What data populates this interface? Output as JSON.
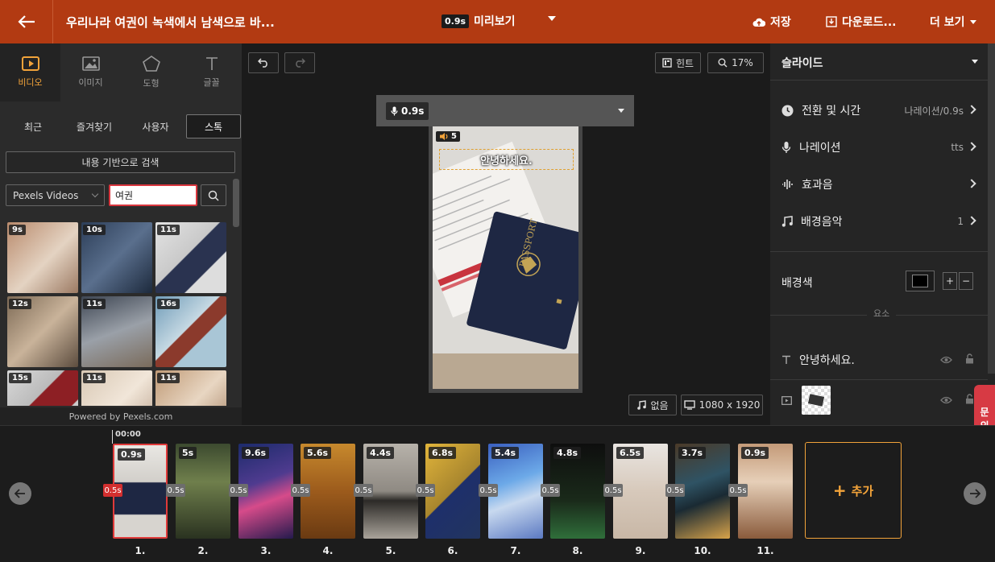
{
  "header": {
    "title": "우리나라 여권이 녹색에서 남색으로 바...",
    "preview_duration": "0.9s",
    "preview_label": "미리보기",
    "save_label": "저장",
    "download_label": "다운로드...",
    "more_label": "더 보기",
    "accent_color": "#b23a12"
  },
  "left_panel": {
    "tabs": [
      {
        "label": "비디오",
        "icon": "video-icon",
        "active": true
      },
      {
        "label": "이미지",
        "icon": "image-icon"
      },
      {
        "label": "도형",
        "icon": "pentagon-icon"
      },
      {
        "label": "글꼴",
        "icon": "text-icon"
      }
    ],
    "subtabs": [
      "최근",
      "즐겨찾기",
      "사용자",
      "스톡"
    ],
    "active_subtab": "스톡",
    "content_search_label": "내용 기반으로 검색",
    "source_select": "Pexels Videos",
    "search_value": "여권",
    "thumbnails": [
      {
        "duration": "9s"
      },
      {
        "duration": "10s"
      },
      {
        "duration": "11s"
      },
      {
        "duration": "12s"
      },
      {
        "duration": "11s"
      },
      {
        "duration": "16s"
      },
      {
        "duration": "15s"
      },
      {
        "duration": "11s"
      },
      {
        "duration": "11s"
      }
    ],
    "powered_by": "Powered by Pexels.com"
  },
  "canvas": {
    "hint_label": "힌트",
    "zoom": "17%",
    "narration_duration": "0.9s",
    "audio_badge": "5",
    "text_overlay": "안녕하세요.",
    "music_label": "없음",
    "resolution": "1080 x 1920"
  },
  "right_panel": {
    "header": "슬라이드",
    "rows": [
      {
        "label": "전환 및 시간",
        "value": "나레이션/0.9s",
        "icon": "clock-icon"
      },
      {
        "label": "나레이션",
        "value": "tts",
        "icon": "mic-icon"
      },
      {
        "label": "효과음",
        "value": "",
        "icon": "waveform-icon"
      },
      {
        "label": "배경음악",
        "value": "1",
        "icon": "music-icon"
      }
    ],
    "bg_color_label": "배경색",
    "bg_color_value": "#000000",
    "elements_label": "요소",
    "elements": [
      {
        "label": "안녕하세요.",
        "icon": "text-icon"
      }
    ]
  },
  "timeline": {
    "start_time": "00:00",
    "slides": [
      {
        "num": "1.",
        "duration": "0.9s"
      },
      {
        "num": "2.",
        "duration": "5s"
      },
      {
        "num": "3.",
        "duration": "9.6s"
      },
      {
        "num": "4.",
        "duration": "5.6s"
      },
      {
        "num": "5.",
        "duration": "4.4s"
      },
      {
        "num": "6.",
        "duration": "6.8s"
      },
      {
        "num": "7.",
        "duration": "5.4s"
      },
      {
        "num": "8.",
        "duration": "4.8s"
      },
      {
        "num": "9.",
        "duration": "6.5s"
      },
      {
        "num": "10.",
        "duration": "3.7s"
      },
      {
        "num": "11.",
        "duration": "0.9s"
      }
    ],
    "transitions": [
      "0.5s",
      "0.5s",
      "0.5s",
      "0.5s",
      "0.5s",
      "0.5s",
      "0.5s",
      "0.5s",
      "0.5s",
      "0.5s",
      "0.5s"
    ],
    "add_label": "추가"
  },
  "side_tab": {
    "line1": "문",
    "line2": "의"
  }
}
